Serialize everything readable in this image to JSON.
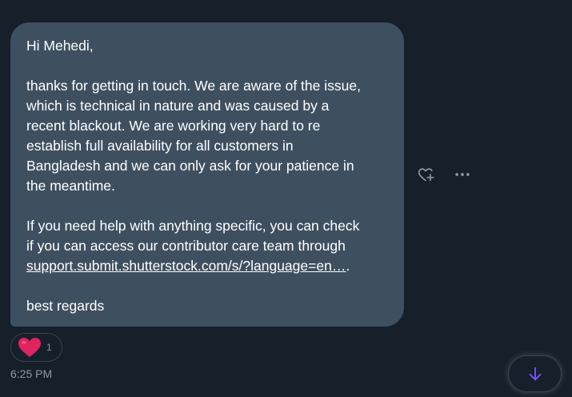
{
  "message": {
    "greeting": "Hi Mehedi,",
    "paragraph1": "thanks for getting in touch. We are aware of the issue,\nwhich is technical in nature and was caused by a\nrecent blackout. We are working very hard to re\nestablish full availability for all customers in\nBangladesh and we can only ask for your patience in\nthe meantime.",
    "paragraph2": "If you need help with anything specific, you can check\nif you can access our contributor care team through",
    "link_text": "support.submit.shutterstock.com/s/?language=en…",
    "link_suffix": ".",
    "closing": "best regards"
  },
  "reaction": {
    "emoji": "heart",
    "count": "1"
  },
  "timestamp": "6:25 PM",
  "icons": {
    "add_reaction": "heart-plus-icon",
    "more": "more-dots-icon",
    "scroll_down": "arrow-down-icon"
  },
  "colors": {
    "background": "#15202b",
    "bubble": "#3e5060",
    "accent": "#7856ff",
    "heart": "#e0245e",
    "muted": "#8b98a5"
  }
}
